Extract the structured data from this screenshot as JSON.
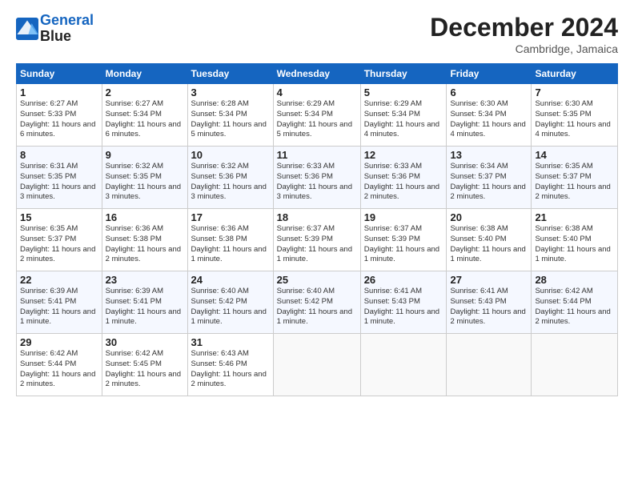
{
  "logo": {
    "line1": "General",
    "line2": "Blue"
  },
  "title": "December 2024",
  "location": "Cambridge, Jamaica",
  "days_header": [
    "Sunday",
    "Monday",
    "Tuesday",
    "Wednesday",
    "Thursday",
    "Friday",
    "Saturday"
  ],
  "weeks": [
    [
      {
        "day": "1",
        "sunrise": "6:27 AM",
        "sunset": "5:33 PM",
        "daylight": "11 hours and 6 minutes."
      },
      {
        "day": "2",
        "sunrise": "6:27 AM",
        "sunset": "5:34 PM",
        "daylight": "11 hours and 6 minutes."
      },
      {
        "day": "3",
        "sunrise": "6:28 AM",
        "sunset": "5:34 PM",
        "daylight": "11 hours and 5 minutes."
      },
      {
        "day": "4",
        "sunrise": "6:29 AM",
        "sunset": "5:34 PM",
        "daylight": "11 hours and 5 minutes."
      },
      {
        "day": "5",
        "sunrise": "6:29 AM",
        "sunset": "5:34 PM",
        "daylight": "11 hours and 4 minutes."
      },
      {
        "day": "6",
        "sunrise": "6:30 AM",
        "sunset": "5:34 PM",
        "daylight": "11 hours and 4 minutes."
      },
      {
        "day": "7",
        "sunrise": "6:30 AM",
        "sunset": "5:35 PM",
        "daylight": "11 hours and 4 minutes."
      }
    ],
    [
      {
        "day": "8",
        "sunrise": "6:31 AM",
        "sunset": "5:35 PM",
        "daylight": "11 hours and 3 minutes."
      },
      {
        "day": "9",
        "sunrise": "6:32 AM",
        "sunset": "5:35 PM",
        "daylight": "11 hours and 3 minutes."
      },
      {
        "day": "10",
        "sunrise": "6:32 AM",
        "sunset": "5:36 PM",
        "daylight": "11 hours and 3 minutes."
      },
      {
        "day": "11",
        "sunrise": "6:33 AM",
        "sunset": "5:36 PM",
        "daylight": "11 hours and 3 minutes."
      },
      {
        "day": "12",
        "sunrise": "6:33 AM",
        "sunset": "5:36 PM",
        "daylight": "11 hours and 2 minutes."
      },
      {
        "day": "13",
        "sunrise": "6:34 AM",
        "sunset": "5:37 PM",
        "daylight": "11 hours and 2 minutes."
      },
      {
        "day": "14",
        "sunrise": "6:35 AM",
        "sunset": "5:37 PM",
        "daylight": "11 hours and 2 minutes."
      }
    ],
    [
      {
        "day": "15",
        "sunrise": "6:35 AM",
        "sunset": "5:37 PM",
        "daylight": "11 hours and 2 minutes."
      },
      {
        "day": "16",
        "sunrise": "6:36 AM",
        "sunset": "5:38 PM",
        "daylight": "11 hours and 2 minutes."
      },
      {
        "day": "17",
        "sunrise": "6:36 AM",
        "sunset": "5:38 PM",
        "daylight": "11 hours and 1 minute."
      },
      {
        "day": "18",
        "sunrise": "6:37 AM",
        "sunset": "5:39 PM",
        "daylight": "11 hours and 1 minute."
      },
      {
        "day": "19",
        "sunrise": "6:37 AM",
        "sunset": "5:39 PM",
        "daylight": "11 hours and 1 minute."
      },
      {
        "day": "20",
        "sunrise": "6:38 AM",
        "sunset": "5:40 PM",
        "daylight": "11 hours and 1 minute."
      },
      {
        "day": "21",
        "sunrise": "6:38 AM",
        "sunset": "5:40 PM",
        "daylight": "11 hours and 1 minute."
      }
    ],
    [
      {
        "day": "22",
        "sunrise": "6:39 AM",
        "sunset": "5:41 PM",
        "daylight": "11 hours and 1 minute."
      },
      {
        "day": "23",
        "sunrise": "6:39 AM",
        "sunset": "5:41 PM",
        "daylight": "11 hours and 1 minute."
      },
      {
        "day": "24",
        "sunrise": "6:40 AM",
        "sunset": "5:42 PM",
        "daylight": "11 hours and 1 minute."
      },
      {
        "day": "25",
        "sunrise": "6:40 AM",
        "sunset": "5:42 PM",
        "daylight": "11 hours and 1 minute."
      },
      {
        "day": "26",
        "sunrise": "6:41 AM",
        "sunset": "5:43 PM",
        "daylight": "11 hours and 1 minute."
      },
      {
        "day": "27",
        "sunrise": "6:41 AM",
        "sunset": "5:43 PM",
        "daylight": "11 hours and 2 minutes."
      },
      {
        "day": "28",
        "sunrise": "6:42 AM",
        "sunset": "5:44 PM",
        "daylight": "11 hours and 2 minutes."
      }
    ],
    [
      {
        "day": "29",
        "sunrise": "6:42 AM",
        "sunset": "5:44 PM",
        "daylight": "11 hours and 2 minutes."
      },
      {
        "day": "30",
        "sunrise": "6:42 AM",
        "sunset": "5:45 PM",
        "daylight": "11 hours and 2 minutes."
      },
      {
        "day": "31",
        "sunrise": "6:43 AM",
        "sunset": "5:46 PM",
        "daylight": "11 hours and 2 minutes."
      },
      null,
      null,
      null,
      null
    ]
  ]
}
